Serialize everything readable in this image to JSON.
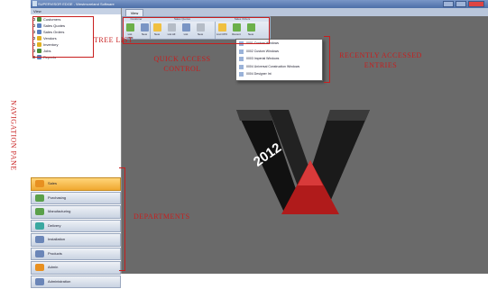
{
  "window": {
    "title": "SUPERVISOR EDGE - Westmoreland Software",
    "tab": "View"
  },
  "nav": {
    "header": "View",
    "tree": [
      {
        "label": "Customers",
        "icon": "customers-icon"
      },
      {
        "label": "Sales Quotes",
        "icon": "quote-icon"
      },
      {
        "label": "Sales Orders",
        "icon": "order-icon"
      },
      {
        "label": "Vendors",
        "icon": "vendor-icon"
      },
      {
        "label": "Inventory",
        "icon": "inventory-icon"
      },
      {
        "label": "Jobs",
        "icon": "jobs-icon"
      },
      {
        "label": "Reports",
        "icon": "reports-icon"
      }
    ],
    "departments": [
      {
        "label": "Sales",
        "selected": true
      },
      {
        "label": "Purchasing",
        "selected": false
      },
      {
        "label": "Manufacturing",
        "selected": false
      },
      {
        "label": "Delivery",
        "selected": false
      },
      {
        "label": "Installation",
        "selected": false
      },
      {
        "label": "Products",
        "selected": false
      },
      {
        "label": "Admin",
        "selected": false
      },
      {
        "label": "Administration",
        "selected": false
      }
    ]
  },
  "ribbon": {
    "groups": [
      {
        "label": "Customer",
        "buttons": [
          "List CRM",
          "New"
        ]
      },
      {
        "label": "Sales Quotes",
        "buttons": [
          "New",
          "List All",
          "List",
          "New"
        ]
      },
      {
        "label": "Sales Orders",
        "buttons": [
          "List CPO",
          "Recent",
          "New"
        ]
      }
    ]
  },
  "recent": {
    "items": [
      "0001 Custom Windows",
      "0002 Custom Windows",
      "0003 Imperial Windows",
      "0004 Universal Construction Windows",
      "0004 Designer Int"
    ]
  },
  "logo": {
    "year": "2012"
  },
  "annotations": {
    "tree_list": "TREE LIST",
    "quick_access": "QUICK ACCESS CONTROL",
    "recent": "RECENTLY ACCESSED ENTRIES",
    "navigation_pane": "NAVIGATION PANE",
    "departments": "DEPARTMENTS"
  },
  "colors": {
    "annotation": "#c81e1e",
    "workspace": "#6a6a6a",
    "accent": "#f0a830"
  }
}
